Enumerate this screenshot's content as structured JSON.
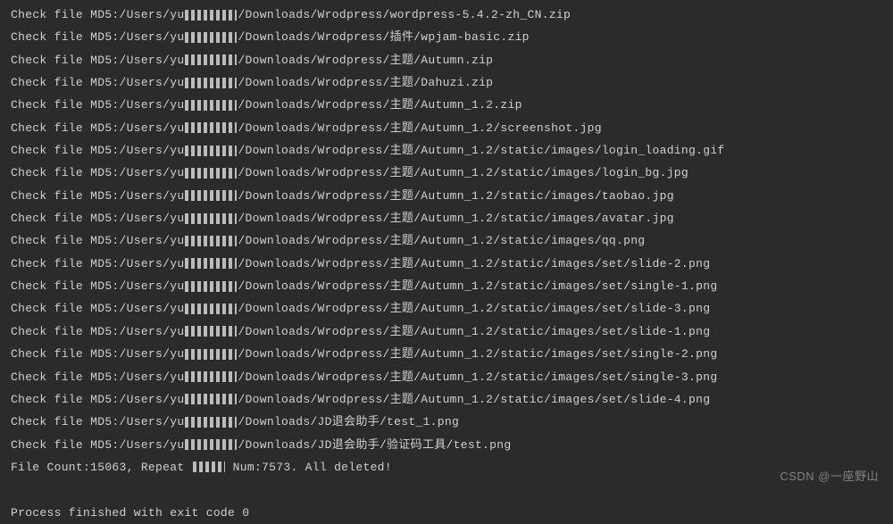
{
  "terminal": {
    "line_prefix": "Check file MD5:/Users/yu",
    "redacted_placeholder": "▪▪▪▪▪",
    "lines": [
      "/Downloads/Wrodpress/wordpress-5.4.2-zh_CN.zip",
      "/Downloads/Wrodpress/插件/wpjam-basic.zip",
      "/Downloads/Wrodpress/主题/Autumn.zip",
      "/Downloads/Wrodpress/主题/Dahuzi.zip",
      "/Downloads/Wrodpress/主题/Autumn_1.2.zip",
      "/Downloads/Wrodpress/主题/Autumn_1.2/screenshot.jpg",
      "/Downloads/Wrodpress/主题/Autumn_1.2/static/images/login_loading.gif",
      "/Downloads/Wrodpress/主题/Autumn_1.2/static/images/login_bg.jpg",
      "/Downloads/Wrodpress/主题/Autumn_1.2/static/images/taobao.jpg",
      "/Downloads/Wrodpress/主题/Autumn_1.2/static/images/avatar.jpg",
      "/Downloads/Wrodpress/主题/Autumn_1.2/static/images/qq.png",
      "/Downloads/Wrodpress/主题/Autumn_1.2/static/images/set/slide-2.png",
      "/Downloads/Wrodpress/主题/Autumn_1.2/static/images/set/single-1.png",
      "/Downloads/Wrodpress/主题/Autumn_1.2/static/images/set/slide-3.png",
      "/Downloads/Wrodpress/主题/Autumn_1.2/static/images/set/slide-1.png",
      "/Downloads/Wrodpress/主题/Autumn_1.2/static/images/set/single-2.png",
      "/Downloads/Wrodpress/主题/Autumn_1.2/static/images/set/single-3.png",
      "/Downloads/Wrodpress/主题/Autumn_1.2/static/images/set/slide-4.png",
      "/Downloads/JD退会助手/test_1.png",
      "/Downloads/JD退会助手/验证码工具/test.png"
    ],
    "summary_prefix": "File Count:15063, Repeat ",
    "summary_suffix": " Num:7573. All deleted!",
    "exit_line": "Process finished with exit code 0"
  },
  "watermark": "CSDN @一座野山"
}
